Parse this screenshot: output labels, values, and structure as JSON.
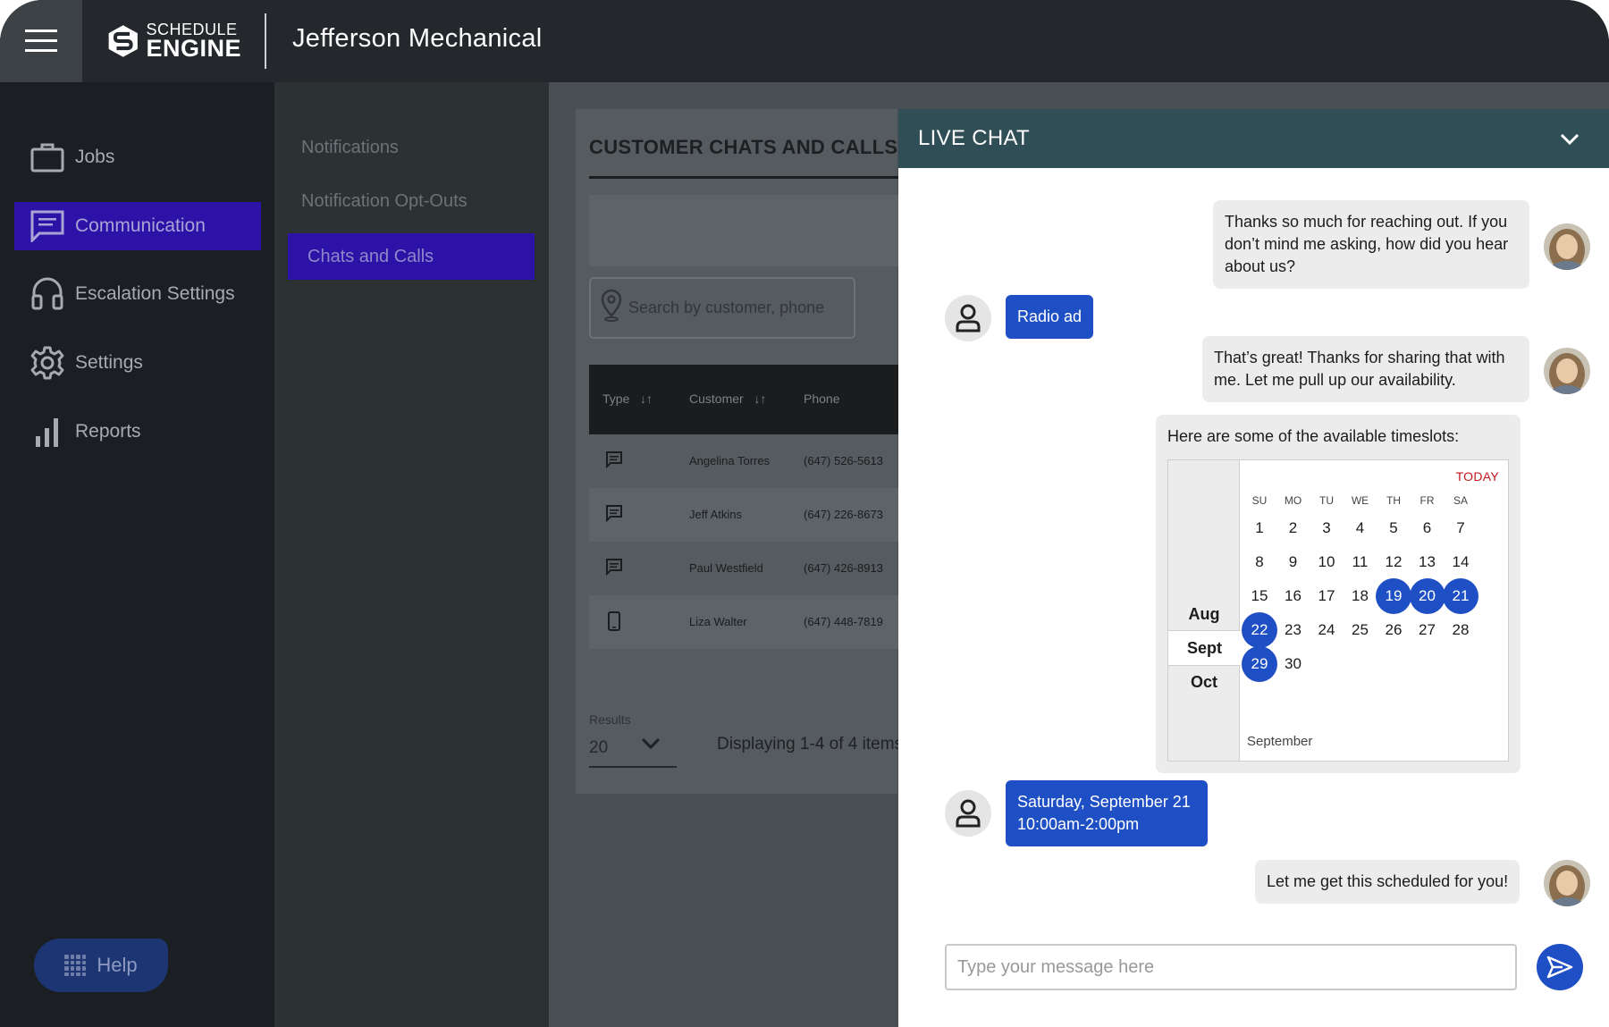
{
  "app": {
    "brand_line1": "SCHEDULE",
    "brand_line2": "ENGINE",
    "company": "Jefferson Mechanical"
  },
  "sidebar": {
    "items": [
      {
        "label": "Jobs",
        "icon": "briefcase-icon"
      },
      {
        "label": "Communication",
        "icon": "chat-icon",
        "active": true
      },
      {
        "label": "Escalation Settings",
        "icon": "headset-icon"
      },
      {
        "label": "Settings",
        "icon": "gear-icon"
      },
      {
        "label": "Reports",
        "icon": "bar-chart-icon"
      }
    ],
    "help_label": "Help"
  },
  "submenu": {
    "items": [
      {
        "label": "Notifications"
      },
      {
        "label": "Notification Opt-Outs"
      },
      {
        "label": "Chats and Calls",
        "active": true
      }
    ]
  },
  "main": {
    "title": "CUSTOMER CHATS AND CALLS",
    "search_placeholder": "Search by customer, phone",
    "table": {
      "headers": [
        "Type",
        "Customer",
        "Phone"
      ],
      "rows": [
        {
          "type": "chat",
          "customer": "Angelina Torres",
          "phone": "(647) 526-5613"
        },
        {
          "type": "chat",
          "customer": "Jeff Atkins",
          "phone": "(647) 226-8673"
        },
        {
          "type": "chat",
          "customer": "Paul Westfield",
          "phone": "(647) 426-8913"
        },
        {
          "type": "call",
          "customer": "Liza Walter",
          "phone": "(647) 448-7819"
        }
      ]
    },
    "results_label": "Results",
    "results_value": "20",
    "displaying": "Displaying 1-4 of 4 items"
  },
  "chat": {
    "title": "LIVE CHAT",
    "messages": {
      "m1": "Thanks so much for reaching out. If you don’t mind me asking, how did you hear about us?",
      "m2": "Radio ad",
      "m3": "That’s great! Thanks for sharing that with me. Let me pull up our availability.",
      "m4": "Here are some of the available timeslots:",
      "m5_line1": "Saturday, September 21",
      "m5_line2": "10:00am-2:00pm",
      "m6": "Let me get this scheduled for you!"
    },
    "calendar": {
      "today_label": "TODAY",
      "months": [
        "Aug",
        "Sept",
        "Oct"
      ],
      "selected_month": "Sept",
      "weekdays": [
        "SU",
        "MO",
        "TU",
        "WE",
        "TH",
        "FR",
        "SA"
      ],
      "weeks": [
        [
          "1",
          "2",
          "3",
          "4",
          "5",
          "6",
          "7"
        ],
        [
          "8",
          "9",
          "10",
          "11",
          "12",
          "13",
          "14"
        ],
        [
          "15",
          "16",
          "17",
          "18",
          "19",
          "20",
          "21"
        ],
        [
          "22",
          "23",
          "24",
          "25",
          "26",
          "27",
          "28"
        ],
        [
          "29",
          "30"
        ]
      ],
      "available_days": [
        "19",
        "20",
        "21",
        "22",
        "29"
      ],
      "footer_month": "September"
    },
    "input_placeholder": "Type your message here",
    "accent_color": "#1f4fc4",
    "header_color": "#2f4e55"
  }
}
